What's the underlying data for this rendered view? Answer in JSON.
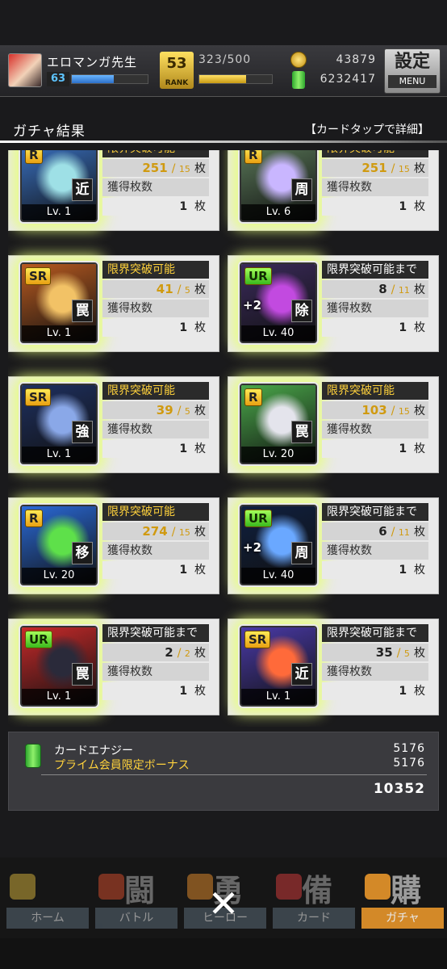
{
  "player": {
    "name": "エロマンガ先生",
    "level": "63",
    "exp_fraction": 0.55,
    "rank_icon_text": "53",
    "rank_icon_label": "RANK",
    "rank_value": "323/500",
    "rank_fraction": 0.64,
    "coins": "43879",
    "energy": "6232417"
  },
  "settings": {
    "label": "設定",
    "sub": "MENU"
  },
  "header": {
    "title": "ガチャ結果",
    "hint": "【カードタップで詳細】"
  },
  "labels": {
    "obtained": "獲得枚数",
    "unit": "枚"
  },
  "cards": [
    {
      "rarity": "R",
      "plus": "",
      "role": "近",
      "level": "Lv. 1",
      "status": "限界突破可能",
      "status_color": "yellow",
      "count": "251",
      "max": "15",
      "obtained_count": "1",
      "bg": "#3a72c4",
      "accent": "#9ee0e6"
    },
    {
      "rarity": "R",
      "plus": "",
      "role": "周",
      "level": "Lv. 6",
      "status": "限界突破可能",
      "status_color": "yellow",
      "count": "251",
      "max": "15",
      "obtained_count": "1",
      "bg": "#5b7a5a",
      "accent": "#c9b6ff"
    },
    {
      "rarity": "SR",
      "plus": "",
      "role": "罠",
      "level": "Lv. 1",
      "status": "限界突破可能",
      "status_color": "yellow",
      "count": "41",
      "max": "5",
      "obtained_count": "1",
      "bg": "#b85a20",
      "accent": "#f2c266"
    },
    {
      "rarity": "UR",
      "plus": "+2",
      "role": "除",
      "level": "Lv. 40",
      "status": "限界突破可能まで",
      "status_color": "white",
      "count": "8",
      "max": "11",
      "obtained_count": "1",
      "bg": "#3a2a5a",
      "accent": "#c24ae0"
    },
    {
      "rarity": "SR",
      "plus": "",
      "role": "強",
      "level": "Lv. 1",
      "status": "限界突破可能",
      "status_color": "yellow",
      "count": "39",
      "max": "5",
      "obtained_count": "1",
      "bg": "#1e3060",
      "accent": "#8aa8e8"
    },
    {
      "rarity": "R",
      "plus": "",
      "role": "罠",
      "level": "Lv. 20",
      "status": "限界突破可能",
      "status_color": "yellow",
      "count": "103",
      "max": "15",
      "obtained_count": "1",
      "bg": "#4aa84a",
      "accent": "#e4e4ec"
    },
    {
      "rarity": "R",
      "plus": "",
      "role": "移",
      "level": "Lv. 20",
      "status": "限界突破可能",
      "status_color": "yellow",
      "count": "274",
      "max": "15",
      "obtained_count": "1",
      "bg": "#2a6ad8",
      "accent": "#5ee04a"
    },
    {
      "rarity": "UR",
      "plus": "+2",
      "role": "周",
      "level": "Lv. 40",
      "status": "限界突破可能まで",
      "status_color": "white",
      "count": "6",
      "max": "11",
      "obtained_count": "1",
      "bg": "#102040",
      "accent": "#6aa8ff"
    },
    {
      "rarity": "UR",
      "plus": "",
      "role": "罠",
      "level": "Lv. 1",
      "status": "限界突破可能まで",
      "status_color": "white",
      "count": "2",
      "max": "2",
      "obtained_count": "1",
      "bg": "#c82a2a",
      "accent": "#2a2a3a"
    },
    {
      "rarity": "SR",
      "plus": "",
      "role": "近",
      "level": "Lv. 1",
      "status": "限界突破可能まで",
      "status_color": "white",
      "count": "35",
      "max": "5",
      "obtained_count": "1",
      "bg": "#4a3aa8",
      "accent": "#ff6a3a"
    }
  ],
  "summary": {
    "label1": "カードエナジー",
    "value1": "5176",
    "label2": "プライム会員限定ボーナス",
    "value2": "5176",
    "total": "10352"
  },
  "nav": [
    {
      "label": "ホーム",
      "kanji": "",
      "active": false
    },
    {
      "label": "バトル",
      "kanji": "闘",
      "active": false
    },
    {
      "label": "ヒーロー",
      "kanji": "勇",
      "active": false
    },
    {
      "label": "カード",
      "kanji": "備",
      "active": false
    },
    {
      "label": "ガチャ",
      "kanji": "購",
      "active": true
    }
  ],
  "close_symbol": "✕"
}
